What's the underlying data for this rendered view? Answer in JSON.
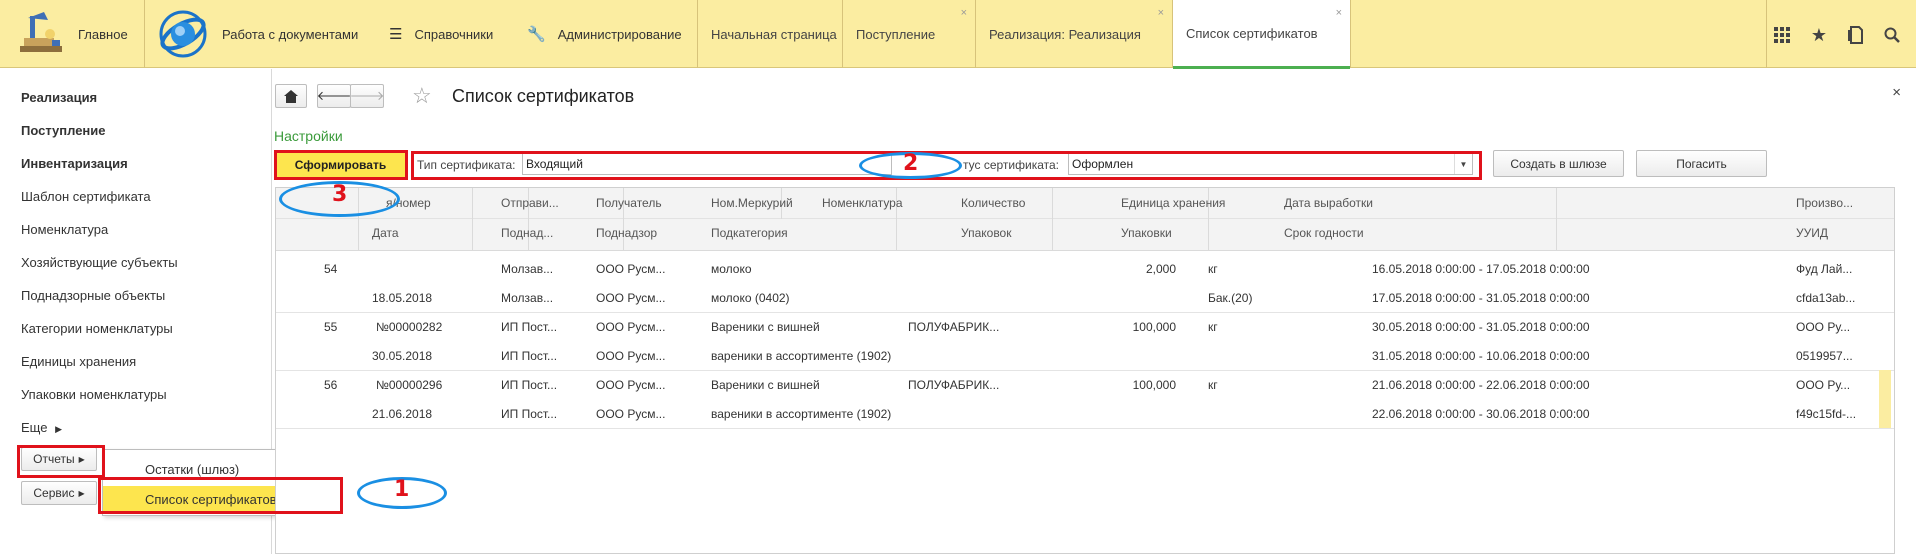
{
  "topbar": {
    "home_label": "Главное",
    "sections": [
      {
        "label": "Работа с документами"
      },
      {
        "label": "Справочники"
      },
      {
        "label": "Администрирование"
      }
    ],
    "tabs": [
      {
        "label": "Начальная страница"
      },
      {
        "label": "Поступление"
      },
      {
        "label": "Реализация: Реализация"
      },
      {
        "label": "Список сертификатов"
      }
    ],
    "tab_close": "×",
    "icons": [
      "apps-grid-icon",
      "star-icon",
      "history-icon",
      "search-icon"
    ]
  },
  "left_panel": {
    "items": [
      {
        "label": "Реализация",
        "bold": true
      },
      {
        "label": "Поступление",
        "bold": true
      },
      {
        "label": "Инвентаризация",
        "bold": true
      },
      {
        "label": "Шаблон сертификата"
      },
      {
        "label": "Номенклатура"
      },
      {
        "label": "Хозяйствующие субъекты"
      },
      {
        "label": "Поднадзорные объекты"
      },
      {
        "label": "Категории номенклатуры"
      },
      {
        "label": "Единицы хранения"
      },
      {
        "label": "Упаковки номенклатуры"
      },
      {
        "label": "Еще"
      }
    ],
    "reports_button": "Отчеты",
    "service_button": "Сервис",
    "submenu": [
      {
        "label": "Остатки (шлюз)"
      },
      {
        "label": "Список сертификатов"
      }
    ]
  },
  "form": {
    "title": "Список сертификатов",
    "close": "×",
    "settings_link": "Настройки",
    "generate_button": "Сформировать",
    "cert_type_label": "Тип сертификата:",
    "cert_type_value": "Входящий",
    "cert_status_label": "тус сертификата:",
    "cert_status_value": "Оформлен",
    "create_gateway_button": "Создать в шлюзе",
    "redeem_button": "Погасить"
  },
  "grid": {
    "header_row1": [
      "я/номер",
      "Отправи...",
      "Получатель",
      "Ном.Меркурий",
      "Номенклатура",
      "Количество",
      "Единица хранения",
      "Дата выработки",
      "Произво..."
    ],
    "header_row2": [
      "Дата",
      "Поднад...",
      "Поднадзор",
      "Подкатегория",
      "",
      "Упаковок",
      "Упаковки",
      "Срок годности",
      "УУИД"
    ],
    "rows": [
      {
        "num": "54",
        "l1": [
          "",
          "Молзав...",
          "ООО Русм...",
          "молоко",
          "",
          "2,000",
          "кг",
          "16.05.2018 0:00:00 - 17.05.2018 0:00:00",
          "Фуд Лай..."
        ],
        "l2": [
          "18.05.2018",
          "Молзав...",
          "ООО Русм...",
          "молоко (0402)",
          "",
          "",
          "Бак.(20)",
          "17.05.2018 0:00:00 - 31.05.2018 0:00:00",
          "cfda13ab..."
        ]
      },
      {
        "num": "55",
        "l1": [
          "№00000282",
          "ИП Пост...",
          "ООО Русм...",
          "Вареники с вишней",
          "ПОЛУФАБРИК...",
          "100,000",
          "кг",
          "30.05.2018 0:00:00 - 31.05.2018 0:00:00",
          "ООО Ру..."
        ],
        "l2": [
          "30.05.2018",
          "ИП Пост...",
          "ООО Русм...",
          "вареники в ассортименте (1902)",
          "",
          "",
          "",
          "31.05.2018 0:00:00 - 10.06.2018 0:00:00",
          "0519957..."
        ]
      },
      {
        "num": "56",
        "l1": [
          "№00000296",
          "ИП Пост...",
          "ООО Русм...",
          "Вареники с вишней",
          "ПОЛУФАБРИК...",
          "100,000",
          "кг",
          "21.06.2018 0:00:00 - 22.06.2018 0:00:00",
          "ООО Ру..."
        ],
        "l2": [
          "21.06.2018",
          "ИП Пост...",
          "ООО Русм...",
          "вареники в ассортименте (1902)",
          "",
          "",
          "",
          "22.06.2018 0:00:00 - 30.06.2018 0:00:00",
          "f49c15fd-..."
        ]
      }
    ]
  },
  "annotations": {
    "num1": "1",
    "num2": "2",
    "num3": "3",
    "red_color": "#e0121b",
    "blue_color": "#1a8fe3"
  }
}
